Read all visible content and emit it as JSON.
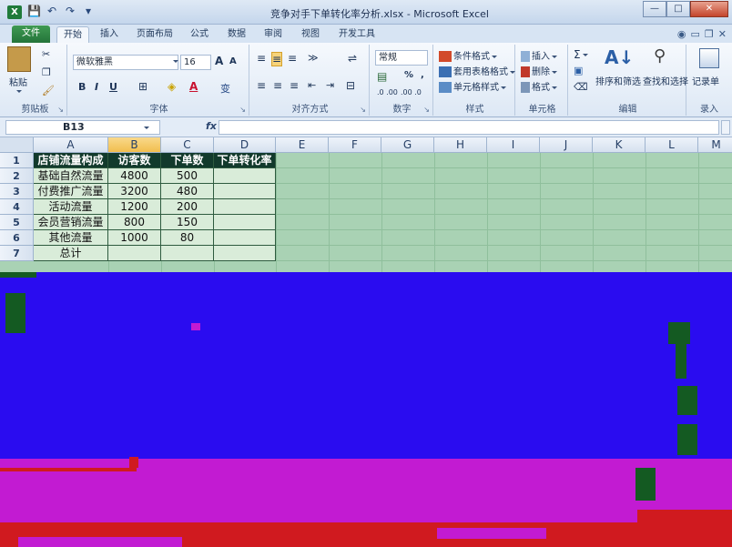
{
  "window": {
    "app_icon": "X",
    "title": "竞争对手下单转化率分析.xlsx - Microsoft Excel",
    "controls": {
      "minimize": "—",
      "maximize": "□",
      "close": "✕"
    }
  },
  "qat": {
    "save": "💾",
    "undo": "↶",
    "redo": "↷",
    "customize": "▾"
  },
  "tabs": {
    "file": "文件",
    "items": [
      "开始",
      "插入",
      "页面布局",
      "公式",
      "数据",
      "审阅",
      "视图",
      "开发工具"
    ],
    "active": "开始",
    "right_icons": [
      "help-icon",
      "minimize-ribbon-icon",
      "restore-icon",
      "close-workbook-icon"
    ]
  },
  "ribbon": {
    "clipboard": {
      "label": "剪贴板",
      "paste": "粘贴"
    },
    "font": {
      "label": "字体",
      "font_name": "微软雅黑",
      "font_size": "16",
      "bold": "B",
      "italic": "I",
      "underline": "U",
      "grow": "A",
      "shrink": "A",
      "phonetic": "变"
    },
    "alignment": {
      "label": "对齐方式"
    },
    "number": {
      "label": "数字",
      "format": "常规",
      "percent": "%",
      "comma": ",",
      "inc_decimal": ".0 .00",
      "dec_decimal": ".00 .0"
    },
    "styles": {
      "label": "样式",
      "conditional": "条件格式",
      "table": "套用表格格式",
      "cell": "单元格样式"
    },
    "cells": {
      "label": "单元格",
      "insert": "插入",
      "delete": "删除",
      "format": "格式"
    },
    "editing": {
      "label": "编辑",
      "sum": "Σ",
      "sort_filter": "排序和筛选",
      "find_select": "查找和选择"
    },
    "record": {
      "label": "录入",
      "record_sheet": "记录单"
    }
  },
  "formula_bar": {
    "name_box": "B13",
    "fx": "fx",
    "formula": ""
  },
  "sheet": {
    "columns": [
      "A",
      "B",
      "C",
      "D",
      "E",
      "F",
      "G",
      "H",
      "I",
      "J",
      "K",
      "L",
      "M"
    ],
    "rows": [
      "1",
      "2",
      "3",
      "4",
      "5",
      "6",
      "7"
    ],
    "headers": [
      "店铺流量构成",
      "访客数",
      "下单数",
      "下单转化率"
    ],
    "data": [
      [
        "基础自然流量",
        "4800",
        "500",
        ""
      ],
      [
        "付费推广流量",
        "3200",
        "480",
        ""
      ],
      [
        "活动流量",
        "1200",
        "200",
        ""
      ],
      [
        "会员营销流量",
        "800",
        "150",
        ""
      ],
      [
        "其他流量",
        "1000",
        "80",
        ""
      ],
      [
        "总计",
        "",
        "",
        ""
      ]
    ]
  },
  "colors": {
    "header_fill": "#123a2c",
    "cell_fill": "#d9ecd9",
    "grid_bg": "#a9d2b4",
    "artifact_blue": "#2a0cf0",
    "artifact_magenta": "#c21bd2",
    "artifact_red": "#d01a1f",
    "artifact_green": "#145a22",
    "excel_green": "#24743a"
  }
}
